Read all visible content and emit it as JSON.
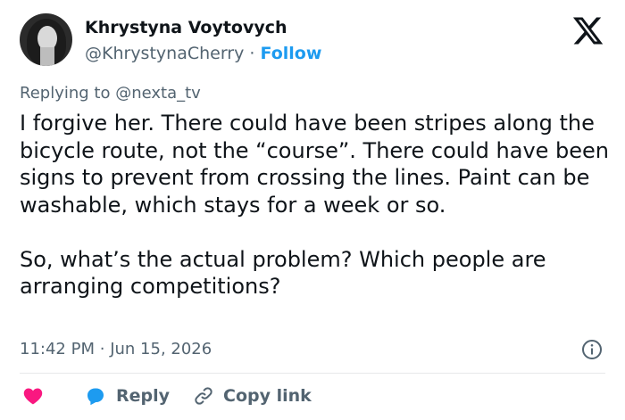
{
  "author": {
    "name": "Khrystyna Voytovych",
    "handle": "@KhrystynaCherry",
    "separator": "·",
    "follow_label": "Follow"
  },
  "replying": {
    "prefix": "Replying to",
    "mention": "@nexta_tv"
  },
  "tweet": {
    "paragraph1": "I forgive her. There could have been stripes along the bicycle route, not the “course”. There could have been signs to prevent from crossing the lines. Paint can be washable, which stays for a week or so.",
    "paragraph2": "So, what’s the actual problem? Which people are arranging competitions?"
  },
  "meta": {
    "time": "11:42 PM",
    "separator": "·",
    "date": "Jun 15, 2026"
  },
  "actions": {
    "like_icon": "heart-icon",
    "reply_label": "Reply",
    "copy_label": "Copy link"
  },
  "colors": {
    "accent": "#1d9bf0",
    "like": "#f91880",
    "muted": "#536471"
  }
}
